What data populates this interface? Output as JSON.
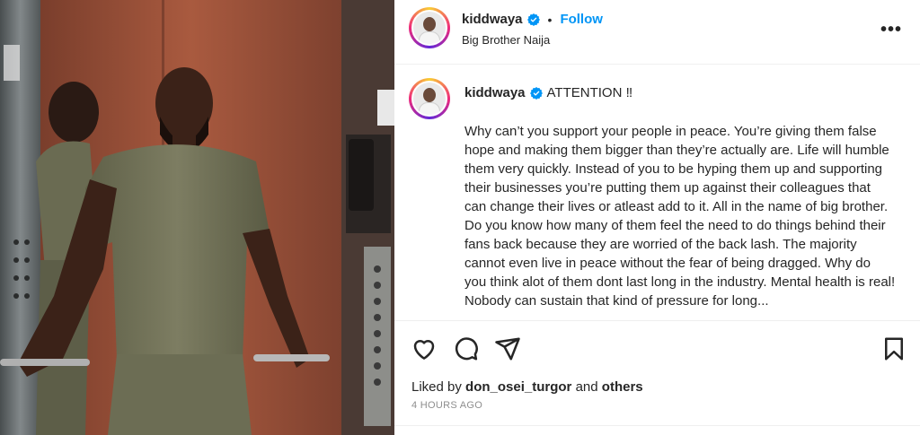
{
  "post": {
    "username": "kiddwaya",
    "follow_label": "Follow",
    "separator": "•",
    "subtitle": "Big Brother Naija",
    "more_label": "•••",
    "caption_title": "ATTENTION ‼",
    "caption_body": "Why can’t you support your people in peace. You’re giving them false hope and making them bigger than they’re actually are. Life will humble them very quickly. Instead of you to be hyping them up and supporting their businesses you’re putting them up against their colleagues that can change their lives or atleast add to it. All in the name of big brother. Do you know how many of them feel the need to do things behind their fans back because they are worried of the back lash. The majority cannot even live in peace without the fear of being dragged. Why do you think alot of them dont last long in the industry. Mental health is real! Nobody can sustain that kind of pressure for long...",
    "liked_by_prefix": "Liked by",
    "liked_by_user": "don_osei_turgor",
    "liked_by_and": "and",
    "liked_by_others": "others",
    "timestamp": "4 HOURS AGO"
  },
  "icons": {
    "verified": "verified-badge-icon",
    "like": "heart-icon",
    "comment": "comment-icon",
    "share": "paper-plane-icon",
    "save": "bookmark-icon",
    "more": "more-options-icon"
  },
  "colors": {
    "follow": "#0095f6",
    "verified": "#0095f6",
    "text": "#262626",
    "muted": "#8e8e8e"
  }
}
